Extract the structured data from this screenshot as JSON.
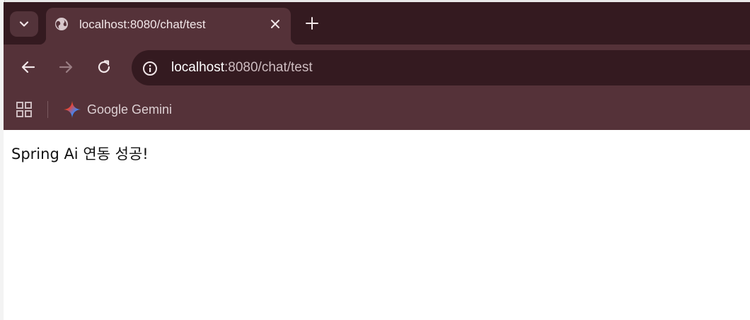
{
  "tab": {
    "title": "localhost:8080/chat/test",
    "favicon": "globe-icon"
  },
  "address_bar": {
    "host": "localhost",
    "path": ":8080/chat/test"
  },
  "bookmarks": [
    {
      "label": "Google Gemini",
      "icon": "gemini-icon"
    }
  ],
  "page": {
    "text": "Spring Ai 연동 성공!"
  },
  "colors": {
    "tab_strip": "#341a20",
    "toolbar": "#553239",
    "omnibox": "#341a20",
    "page_background": "#ffffff"
  }
}
